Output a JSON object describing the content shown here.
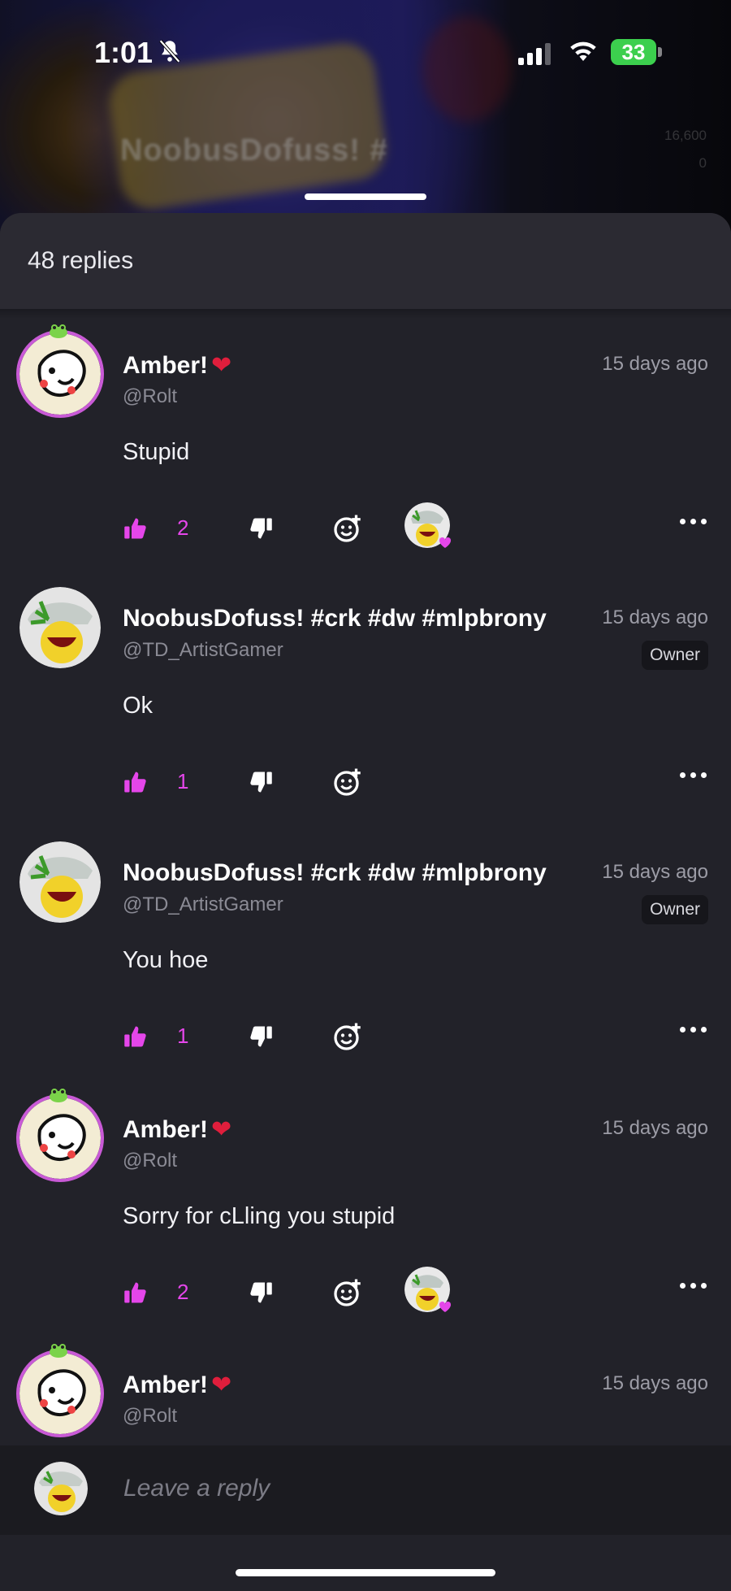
{
  "status_bar": {
    "time": "1:01",
    "battery": "33"
  },
  "background": {
    "title": "NoobusDofuss! #",
    "coins": "16,600",
    "cash": "0"
  },
  "header": {
    "replies_count": "48 replies"
  },
  "colors": {
    "accent": "#e546ea",
    "owner_badge_bg": "#16161b"
  },
  "replies": [
    {
      "name": "Amber!",
      "handle": "@Rolt",
      "date": "15 days ago",
      "badge": "",
      "text": "Stupid",
      "likes": "2",
      "has_heart": true,
      "has_reactor": true
    },
    {
      "name": "NoobusDofuss! #crk #dw #mlpbrony",
      "handle": "@TD_ArtistGamer",
      "date": "15 days ago",
      "badge": "Owner",
      "text": "Ok",
      "likes": "1",
      "has_heart": false,
      "has_reactor": false
    },
    {
      "name": "NoobusDofuss! #crk #dw #mlpbrony",
      "handle": "@TD_ArtistGamer",
      "date": "15 days ago",
      "badge": "Owner",
      "text": "You hoe",
      "likes": "1",
      "has_heart": false,
      "has_reactor": false
    },
    {
      "name": "Amber!",
      "handle": "@Rolt",
      "date": "15 days ago",
      "badge": "",
      "text": "Sorry for cLling you stupid",
      "likes": "2",
      "has_heart": true,
      "has_reactor": true
    },
    {
      "name": "Amber!",
      "handle": "@Rolt",
      "date": "15 days ago",
      "badge": "",
      "text": "",
      "likes": "",
      "has_heart": true,
      "has_reactor": false
    }
  ],
  "composer": {
    "placeholder": "Leave a reply"
  },
  "icons": [
    "bell-slash-icon",
    "signal-icon",
    "wifi-icon",
    "battery-icon",
    "thumbs-up-icon",
    "thumbs-down-icon",
    "add-reaction-icon",
    "more-icon",
    "heart-icon"
  ]
}
